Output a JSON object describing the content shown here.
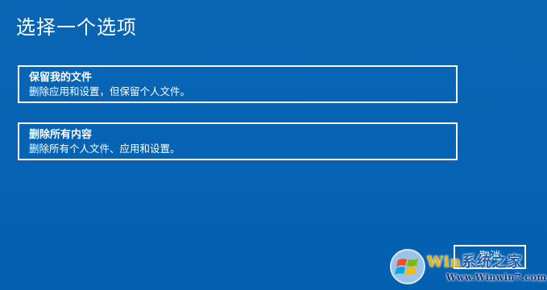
{
  "page": {
    "title": "选择一个选项"
  },
  "options": [
    {
      "title": "保留我的文件",
      "description": "删除应用和设置，但保留个人文件。"
    },
    {
      "title": "删除所有内容",
      "description": "删除所有个人文件、应用和设置。"
    }
  ],
  "buttons": {
    "cancel_label": "取消"
  },
  "watermark": {
    "logo_icon": "windows-flag-icon",
    "brand_prefix": "Win",
    "brand_suffix": "系统之家",
    "url": "Www.Winwin7.com"
  },
  "colors": {
    "background": "#0063b1",
    "foreground": "#ffffff"
  }
}
